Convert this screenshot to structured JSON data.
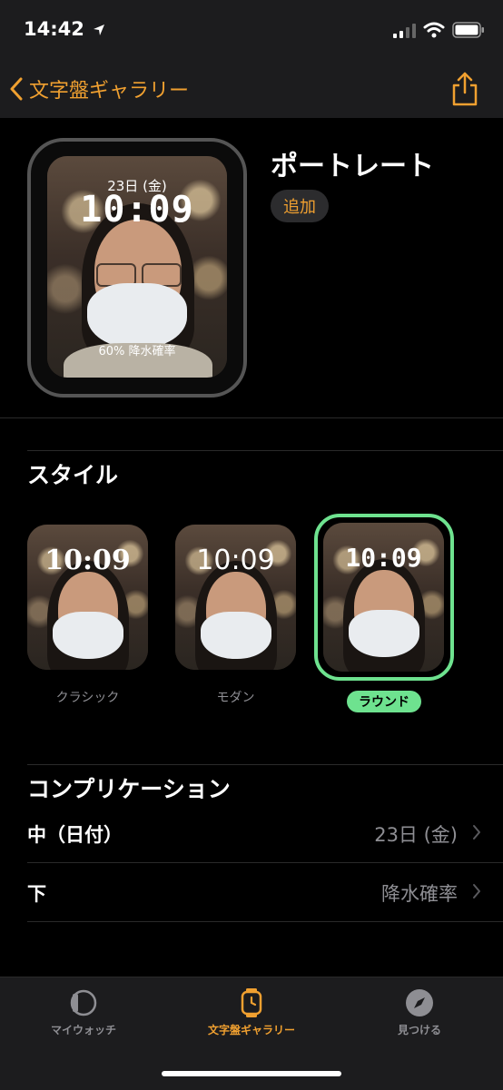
{
  "status_bar": {
    "time": "14:42"
  },
  "nav": {
    "back_label": "文字盤ギャラリー"
  },
  "face": {
    "title": "ポートレート",
    "add_label": "追加",
    "date": "23日 (金)",
    "time": "10:09",
    "complication": "60% 降水確率"
  },
  "style": {
    "heading": "スタイル",
    "options": [
      {
        "label": "クラシック",
        "time": "10:09"
      },
      {
        "label": "モダン",
        "time": "10:09"
      },
      {
        "label": "ラウンド",
        "time": "10:09"
      }
    ],
    "selected": "ラウンド"
  },
  "complications": {
    "heading": "コンプリケーション",
    "rows": [
      {
        "label": "中（日付）",
        "value": "23日 (金)"
      },
      {
        "label": "下",
        "value": "降水確率"
      }
    ]
  },
  "tabs": [
    {
      "label": "マイウォッチ",
      "icon": "watch-outline-icon"
    },
    {
      "label": "文字盤ギャラリー",
      "icon": "watch-face-icon"
    },
    {
      "label": "見つける",
      "icon": "compass-icon"
    }
  ],
  "colors": {
    "accent": "#f0a030",
    "selected": "#6ee28f",
    "background": "#000000",
    "secondary_text": "#8e8e93"
  }
}
